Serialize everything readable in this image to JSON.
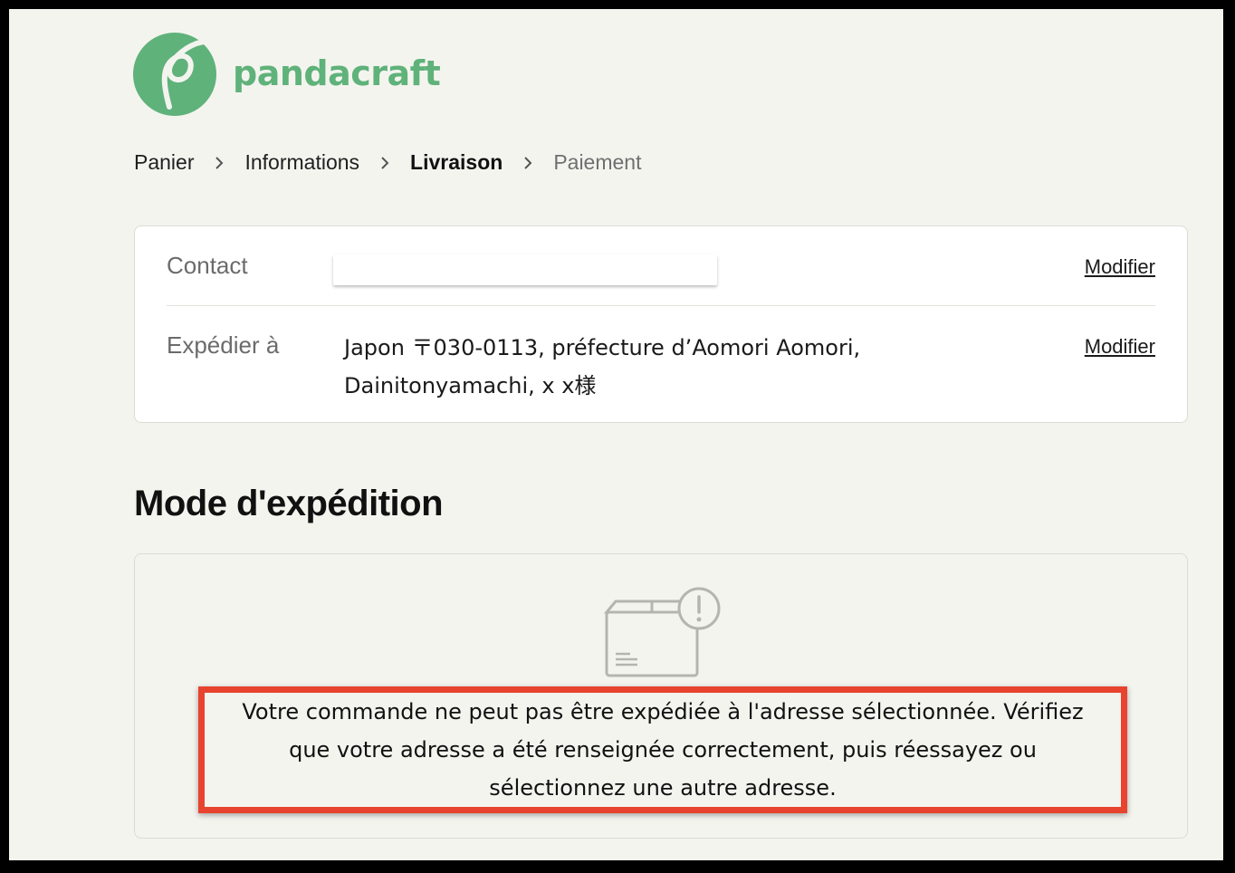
{
  "brand": {
    "name": "pandacraft",
    "accent_color": "#5fb27a",
    "logo_icon": "pandacraft-logo-icon"
  },
  "breadcrumb": {
    "items": [
      {
        "label": "Panier",
        "state": "link"
      },
      {
        "label": "Informations",
        "state": "link"
      },
      {
        "label": "Livraison",
        "state": "current"
      },
      {
        "label": "Paiement",
        "state": "upcoming"
      }
    ],
    "separator_icon": "chevron-right-icon"
  },
  "review": {
    "contact": {
      "label": "Contact",
      "value": "",
      "action": "Modifier"
    },
    "ship_to": {
      "label": "Expédier à",
      "value_line1": "Japon 〒030-0113, préfecture d’Aomori Aomori,",
      "value_line2": "Dainitonyamachi, x x様",
      "action": "Modifier"
    }
  },
  "shipping": {
    "title": "Mode d'expédition",
    "icon": "package-warning-icon",
    "error_line1": "Votre commande ne peut pas être expédiée à l'adresse sélectionnée. Vérifiez",
    "error_line2": "que votre adresse a été renseignée correctement, puis réessayez ou",
    "error_line3": "sélectionnez une autre adresse.",
    "highlight_color": "#e8432e"
  }
}
